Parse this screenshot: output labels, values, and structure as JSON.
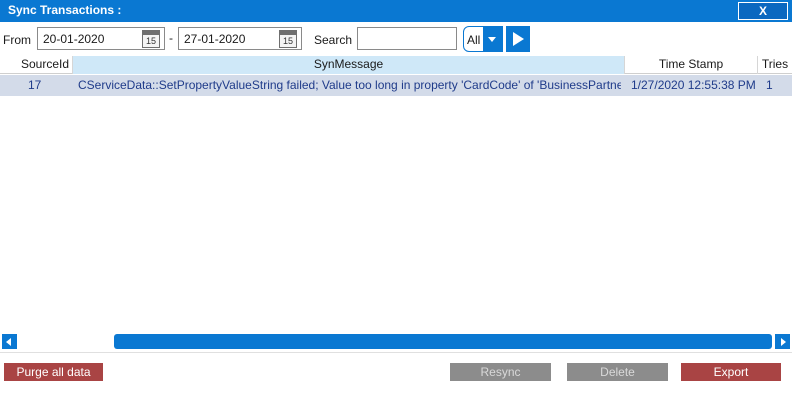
{
  "window": {
    "title": "Sync Transactions :",
    "close_label": "X"
  },
  "filters": {
    "from_label": "From",
    "from_date": "20-01-2020",
    "separator": "-",
    "to_date": "27-01-2020",
    "calendar_day": "15",
    "search_label": "Search",
    "search_value": "",
    "type_selected": "All"
  },
  "table": {
    "columns": [
      "SourceId",
      "SynMessage",
      "Time Stamp",
      "Tries"
    ],
    "rows": [
      {
        "source_id": "17",
        "message": "CServiceData::SetPropertyValueString failed; Value too long in property 'CardCode' of 'BusinessPartner'",
        "timestamp": "1/27/2020 12:55:38 PM",
        "tries": "1"
      }
    ]
  },
  "actions": {
    "purge": "Purge all data",
    "resync": "Resync",
    "delete": "Delete",
    "export": "Export"
  },
  "colors": {
    "accent": "#0a78d2",
    "danger": "#a94444",
    "disabled": "#8c8c8c",
    "selected_row": "#d3dbe9"
  },
  "icons": [
    "calendar-icon",
    "dropdown-arrow-icon",
    "play-icon",
    "scroll-left-icon",
    "scroll-right-icon"
  ]
}
